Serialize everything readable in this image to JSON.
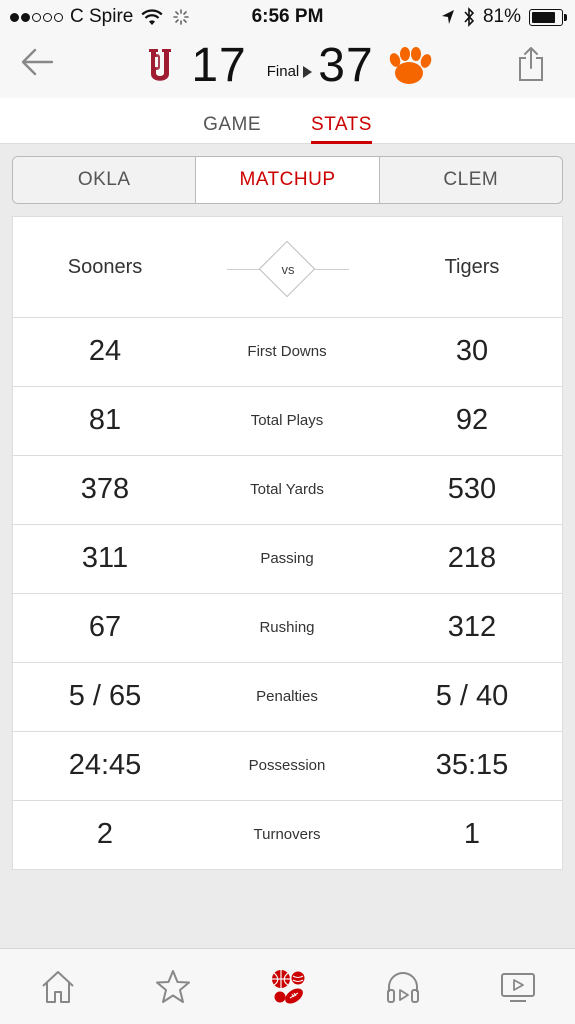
{
  "status_bar": {
    "carrier": "C Spire",
    "time": "6:56 PM",
    "battery": "81%",
    "battery_level": 0.81
  },
  "game": {
    "home_team": {
      "logo": "ou-logo",
      "score": "17"
    },
    "status": "Final",
    "away_team": {
      "logo": "clemson-paw-logo",
      "score": "37"
    }
  },
  "main_tabs": [
    {
      "label": "GAME",
      "active": false
    },
    {
      "label": "STATS",
      "active": true
    }
  ],
  "segments": [
    {
      "label": "OKLA",
      "active": false
    },
    {
      "label": "MATCHUP",
      "active": true
    },
    {
      "label": "CLEM",
      "active": false
    }
  ],
  "matchup": {
    "left_team": "Sooners",
    "vs": "vs",
    "right_team": "Tigers",
    "rows": [
      {
        "label": "First Downs",
        "left": "24",
        "right": "30"
      },
      {
        "label": "Total Plays",
        "left": "81",
        "right": "92"
      },
      {
        "label": "Total Yards",
        "left": "378",
        "right": "530"
      },
      {
        "label": "Passing",
        "left": "311",
        "right": "218"
      },
      {
        "label": "Rushing",
        "left": "67",
        "right": "312"
      },
      {
        "label": "Penalties",
        "left": "5 / 65",
        "right": "5 / 40"
      },
      {
        "label": "Possession",
        "left": "24:45",
        "right": "35:15"
      },
      {
        "label": "Turnovers",
        "left": "2",
        "right": "1"
      }
    ]
  },
  "tab_bar": [
    {
      "icon": "home-icon"
    },
    {
      "icon": "star-icon"
    },
    {
      "icon": "sports-balls-icon",
      "active": true
    },
    {
      "icon": "headphones-icon"
    },
    {
      "icon": "video-icon"
    }
  ],
  "colors": {
    "accent": "#cc0000",
    "ou_crimson": "#9e1b32",
    "clemson_orange": "#f56600"
  }
}
